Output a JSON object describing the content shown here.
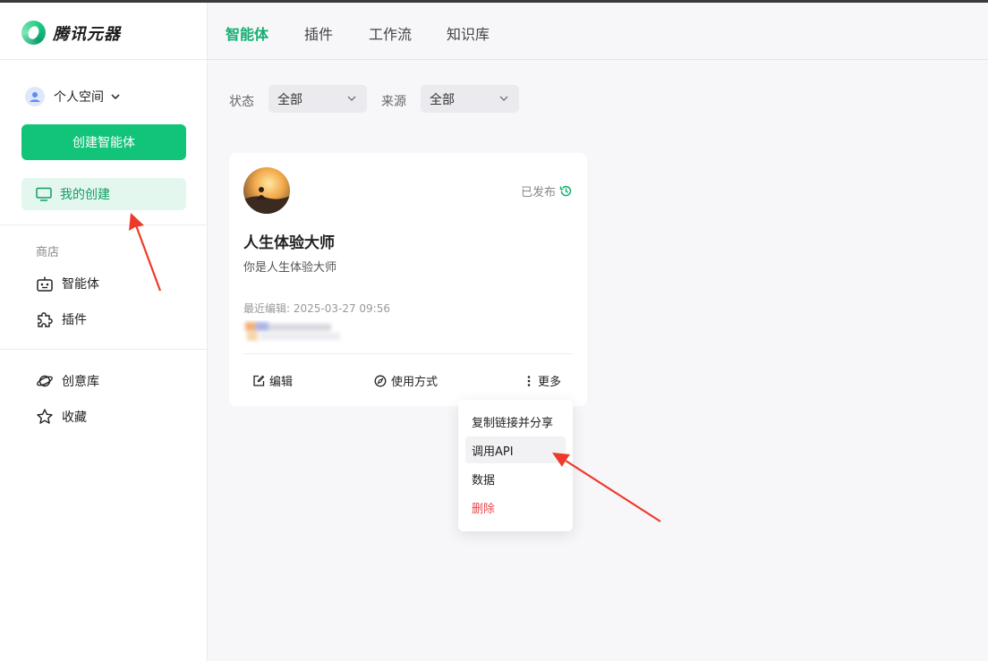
{
  "app": {
    "name": "腾讯元器"
  },
  "sidebar": {
    "space_label": "个人空间",
    "create_label": "创建智能体",
    "mine_label": "我的创建",
    "store_title": "商店",
    "store_items": [
      {
        "label": "智能体",
        "icon": "robot-icon"
      },
      {
        "label": "插件",
        "icon": "puzzle-icon"
      }
    ],
    "extra_items": [
      {
        "label": "创意库",
        "icon": "planet-icon"
      },
      {
        "label": "收藏",
        "icon": "star-icon"
      }
    ]
  },
  "tabs": [
    {
      "label": "智能体",
      "active": true
    },
    {
      "label": "插件",
      "active": false
    },
    {
      "label": "工作流",
      "active": false
    },
    {
      "label": "知识库",
      "active": false
    }
  ],
  "filters": {
    "status_label": "状态",
    "status_value": "全部",
    "source_label": "来源",
    "source_value": "全部"
  },
  "card": {
    "status": "已发布",
    "title": "人生体验大师",
    "description": "你是人生体验大师",
    "edit_time": "最近编辑: 2025-03-27 09:56",
    "actions": {
      "edit": "编辑",
      "usage": "使用方式",
      "more": "更多"
    }
  },
  "menu": {
    "items": [
      {
        "label": "复制链接并分享"
      },
      {
        "label": "调用API"
      },
      {
        "label": "数据"
      },
      {
        "label": "删除"
      }
    ]
  },
  "colors": {
    "brand": "#12c47a",
    "danger": "#e5484d",
    "annotation": "#ee3a2a"
  }
}
